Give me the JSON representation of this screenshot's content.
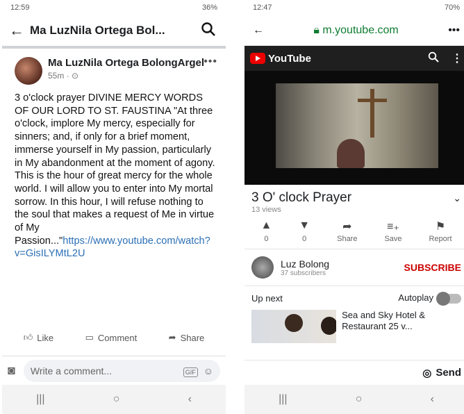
{
  "left": {
    "status": {
      "time": "12:59",
      "battery": "36%"
    },
    "header": {
      "title": "Ma LuzNila Ortega Bol..."
    },
    "post": {
      "author": "Ma LuzNila Ortega BolongArgel",
      "time": "55m · ",
      "text": "3 o'clock prayer DIVINE MERCY WORDS OF OUR LORD TO ST. FAUSTINA \"At three o'clock, implore My mercy, especially for sinners; and, if only for a brief moment, immerse yourself in My passion, particularly in My abandonment at the moment of agony. This is the hour of great mercy for the whole world. I will allow you to enter into My mortal sorrow. In this hour, I will refuse nothing to the soul that makes a request of Me in virtue of My Passion...\"",
      "link": "https://www.youtube.com/watch?v=GisILYMtL2U"
    },
    "actions": {
      "like": "Like",
      "comment": "Comment",
      "share": "Share"
    },
    "comment": {
      "placeholder": "Write a comment...",
      "gif": "GIF"
    }
  },
  "right": {
    "status": {
      "time": "12:47",
      "battery": "70%"
    },
    "url": "m.youtube.com",
    "brand": "YouTube",
    "video": {
      "title": "3 O' clock Prayer",
      "views": "13 views"
    },
    "actions": [
      {
        "icon": "thumbs-up-icon",
        "label": "0"
      },
      {
        "icon": "thumbs-down-icon",
        "label": "0"
      },
      {
        "icon": "share-icon",
        "label": "Share"
      },
      {
        "icon": "save-icon",
        "label": "Save"
      },
      {
        "icon": "flag-icon",
        "label": "Report"
      }
    ],
    "channel": {
      "name": "Luz Bolong",
      "subs": "37 subscribers",
      "subscribe": "SUBSCRIBE"
    },
    "upnext": {
      "label": "Up next",
      "autoplay": "Autoplay"
    },
    "next_video": {
      "title": "Sea and Sky Hotel & Restaurant 25 v..."
    },
    "send": "Send"
  },
  "colors": {
    "fb_link": "#2b6fb6",
    "yt_red": "#cc0000",
    "url_green": "#0f7c32"
  }
}
